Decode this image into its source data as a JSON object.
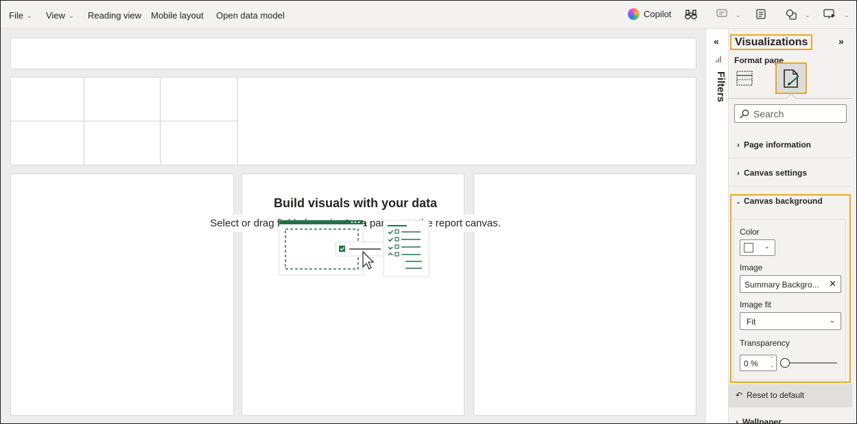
{
  "menu": {
    "file": "File",
    "view": "View",
    "reading_view": "Reading view",
    "mobile_layout": "Mobile layout",
    "open_data_model": "Open data model",
    "copilot": "Copilot"
  },
  "canvas": {
    "placeholder_title": "Build visuals with your data",
    "placeholder_prefix": "Select or drag fields from the ",
    "placeholder_bold": "Data",
    "placeholder_suffix": " pane onto the report canvas."
  },
  "filters": {
    "label": "Filters"
  },
  "visualizations": {
    "title": "Visualizations",
    "format_page": "Format page",
    "search_placeholder": "Search",
    "sections": {
      "page_information": "Page information",
      "canvas_settings": "Canvas settings",
      "canvas_background": "Canvas background",
      "wallpaper": "Wallpaper"
    },
    "canvas_background": {
      "color_label": "Color",
      "color_value": "#FFFFFF",
      "image_label": "Image",
      "image_value": "Summary Backgro...",
      "image_fit_label": "Image fit",
      "image_fit_value": "Fit",
      "transparency_label": "Transparency",
      "transparency_value": "0 %",
      "transparency_fraction": 0
    },
    "reset": "Reset to default"
  },
  "colors": {
    "highlight": "#F2A51A",
    "accent_green": "#217346"
  },
  "icons": {
    "copilot": "copilot-icon",
    "binoculars": "binoculars-icon",
    "format_page": "paintbrush-page-icon",
    "build_visual": "grid-page-icon"
  }
}
